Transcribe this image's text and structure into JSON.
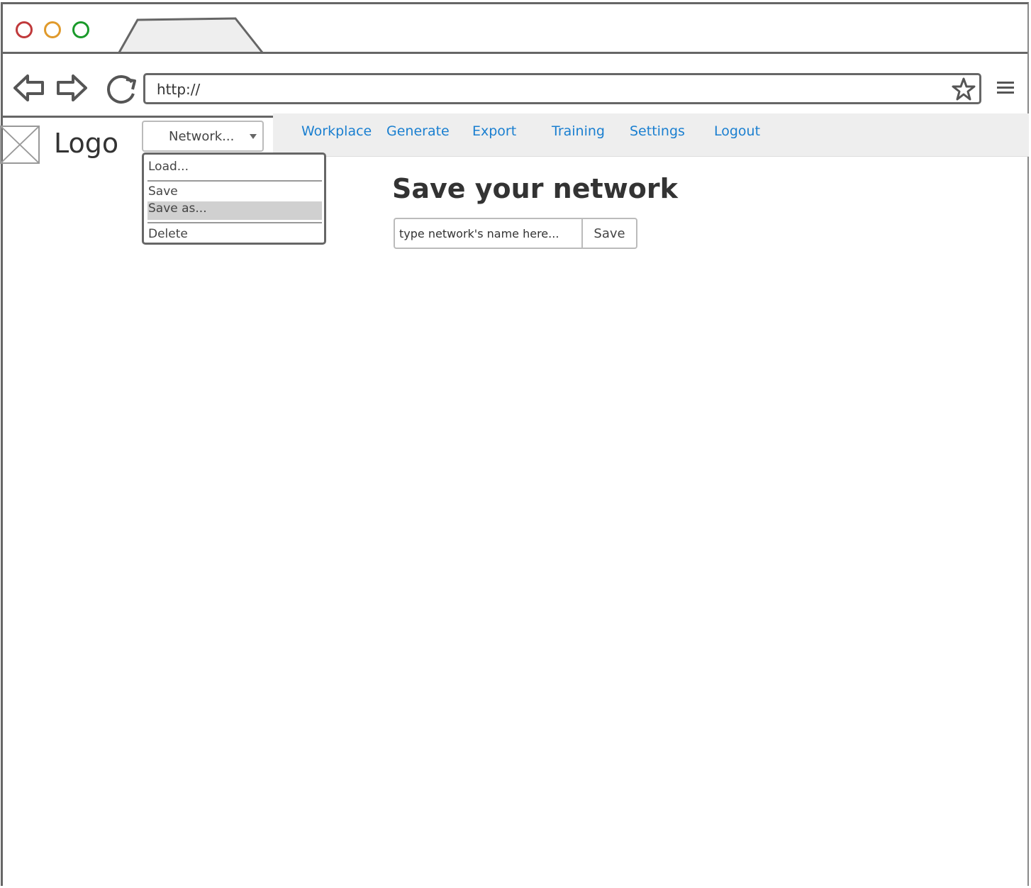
{
  "browser": {
    "url": "http://",
    "window_buttons": {
      "close_color": "#c0393b",
      "minimize_color": "#e09a2c",
      "maximize_color": "#1a9a2a"
    },
    "icons": [
      "back-arrow-icon",
      "forward-arrow-icon",
      "reload-icon",
      "star-icon",
      "hamburger-menu-icon"
    ]
  },
  "header": {
    "logo_text": "Logo",
    "network_select": {
      "label": "Network...",
      "menu": {
        "items": [
          {
            "label": "Load..."
          },
          {
            "label": "Save"
          },
          {
            "label": "Save as...",
            "highlighted": true
          },
          {
            "label": "Delete"
          }
        ]
      }
    },
    "nav": {
      "link_color": "#1a7fd0",
      "links": [
        {
          "label": "Workplace"
        },
        {
          "label": "Generate"
        },
        {
          "label": "Export"
        },
        {
          "label": "Training"
        },
        {
          "label": "Settings"
        },
        {
          "label": "Logout"
        }
      ]
    }
  },
  "main": {
    "title": "Save your network",
    "name_input": {
      "placeholder": "type network's name here..."
    },
    "save_button": "Save"
  }
}
